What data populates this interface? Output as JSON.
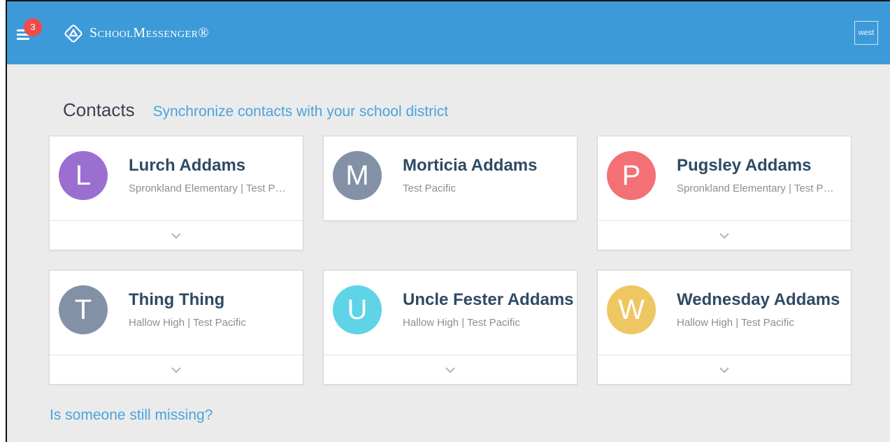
{
  "header": {
    "notification_count": "3",
    "brand": "SchoolMessenger®",
    "district_badge": "west"
  },
  "main": {
    "title": "Contacts",
    "sync_link": "Synchronize contacts with your school district",
    "missing_link": "Is someone still missing?"
  },
  "contacts": [
    {
      "initial": "L",
      "name": "Lurch Addams",
      "schools": "Spronkland Elementary | Test Pacific",
      "color": "#9b6fd0",
      "expandable": true
    },
    {
      "initial": "M",
      "name": "Morticia Addams",
      "schools": "Test Pacific",
      "color": "#8391a6",
      "expandable": false
    },
    {
      "initial": "P",
      "name": "Pugsley Addams",
      "schools": "Spronkland Elementary | Test Pacific",
      "color": "#f37074",
      "expandable": true
    },
    {
      "initial": "T",
      "name": "Thing Thing",
      "schools": "Hallow High | Test Pacific",
      "color": "#8391a6",
      "expandable": true
    },
    {
      "initial": "U",
      "name": "Uncle Fester Addams",
      "schools": "Hallow High | Test Pacific",
      "color": "#5fd4e6",
      "expandable": true
    },
    {
      "initial": "W",
      "name": "Wednesday Addams",
      "schools": "Hallow High | Test Pacific",
      "color": "#efc762",
      "expandable": true
    }
  ],
  "colors": {
    "topbar": "#3d9ad9",
    "link": "#4aa3df",
    "badge": "#f04b4b",
    "name_text": "#2f4a63"
  }
}
